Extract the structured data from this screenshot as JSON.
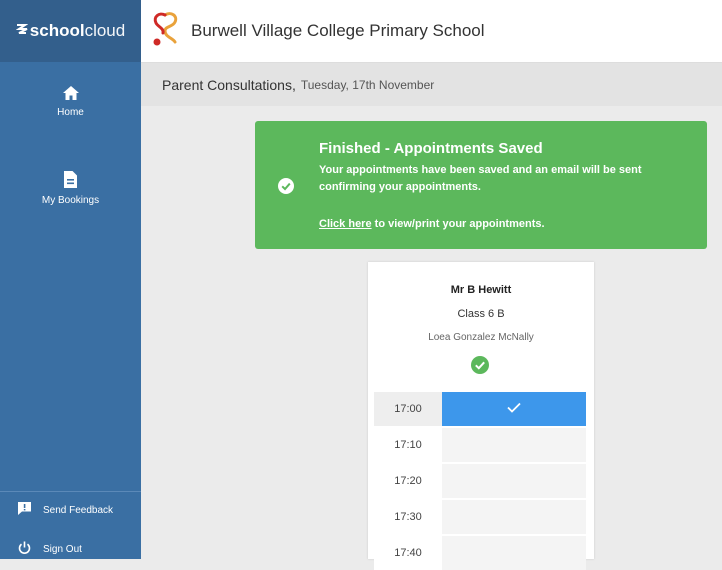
{
  "brand": {
    "name_bold": "school",
    "name_light": "cloud",
    "icon": "schoolcloud-logo-icon"
  },
  "sidebar": {
    "items": [
      {
        "label": "Home",
        "icon": "home-icon"
      },
      {
        "label": "My Bookings",
        "icon": "document-icon"
      }
    ],
    "bottom": [
      {
        "label": "Send Feedback",
        "icon": "feedback-icon"
      },
      {
        "label": "Sign Out",
        "icon": "power-icon"
      }
    ]
  },
  "header": {
    "school_name": "Burwell Village College Primary School",
    "logo_icon": "school-logo-icon"
  },
  "subheader": {
    "title": "Parent Consultations,",
    "date": "Tuesday, 17th November"
  },
  "alert": {
    "title": "Finished - Appointments Saved",
    "message": "Your appointments have been saved and an email will be sent confirming your appointments.",
    "link_text": "Click here",
    "link_suffix": " to view/print your appointments.",
    "icon": "check-circle-icon"
  },
  "appointment": {
    "teacher": "Mr B Hewitt",
    "class": "Class 6 B",
    "pupil": "Loea Gonzalez McNally",
    "status_icon": "check-circle-icon",
    "slots": [
      {
        "time": "17:00",
        "booked": true
      },
      {
        "time": "17:10",
        "booked": false
      },
      {
        "time": "17:20",
        "booked": false
      },
      {
        "time": "17:30",
        "booked": false
      },
      {
        "time": "17:40",
        "booked": false
      }
    ]
  },
  "colors": {
    "sidebar": "#3a6fa3",
    "success": "#5cb85c",
    "booked": "#3d97eb"
  }
}
